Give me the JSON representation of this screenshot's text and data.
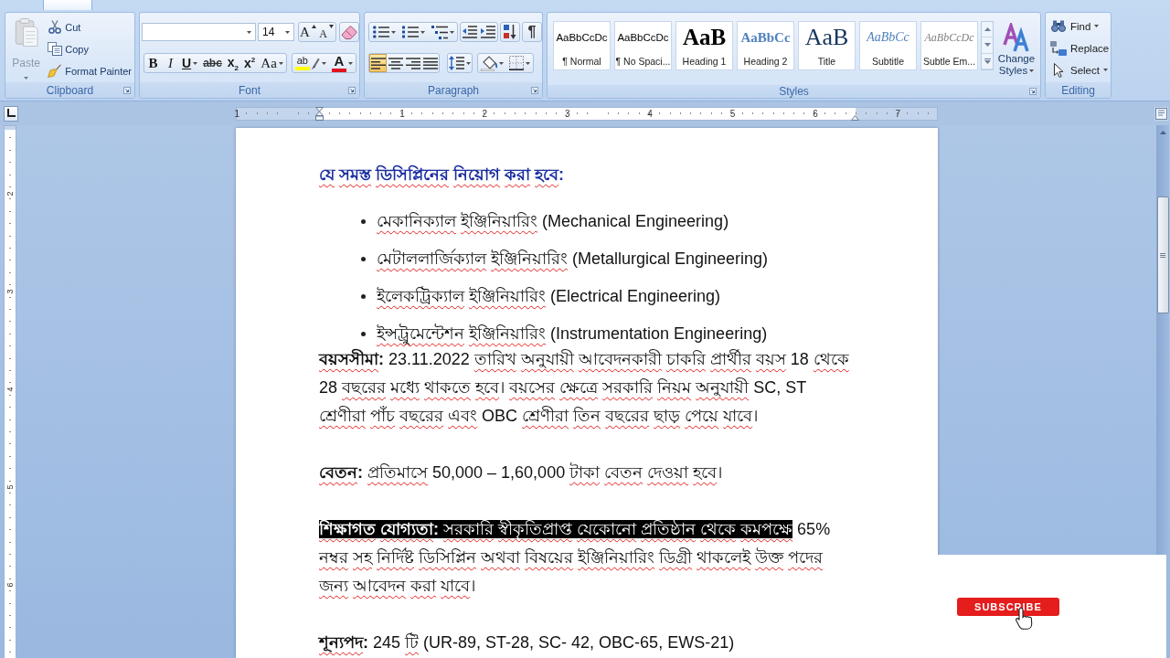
{
  "ribbon": {
    "clipboard": {
      "label": "Clipboard",
      "paste": {
        "label": "Paste",
        "disabled": true
      },
      "items": [
        {
          "kind": "cut",
          "label": "Cut",
          "disabled": false
        },
        {
          "kind": "copy",
          "label": "Copy",
          "disabled": false
        },
        {
          "kind": "painter",
          "label": "Format Painter",
          "disabled": false
        }
      ]
    },
    "font": {
      "label": "Font",
      "size": "14",
      "size_buttons": [
        {
          "kind": "grow",
          "label": "A"
        },
        {
          "kind": "shrink",
          "label": "A"
        }
      ],
      "formatting": [
        {
          "kind": "bold",
          "label": "B"
        },
        {
          "kind": "italic",
          "label": "I"
        },
        {
          "kind": "underline",
          "label": "U"
        },
        {
          "kind": "strike",
          "label": "abc"
        },
        {
          "kind": "subscript",
          "label": "x$_{2}$"
        },
        {
          "kind": "superscript",
          "label": "x$^{2}$"
        },
        {
          "kind": "case",
          "label": "Aa"
        }
      ],
      "highlight": {
        "label": "ab",
        "color": "#ffff00"
      },
      "font_color": {
        "label": "A",
        "color": "#e0141e"
      }
    },
    "paragraph": {
      "label": "Paragraph",
      "show_marks": "¶",
      "alignment": [
        {
          "kind": "left",
          "selected": true
        },
        {
          "kind": "center",
          "selected": false
        },
        {
          "kind": "right",
          "selected": false
        },
        {
          "kind": "justify",
          "selected": false
        }
      ]
    },
    "styles": {
      "label": "Styles",
      "gallery": [
        {
          "kind": "normal",
          "preview": "AaBbCcDc",
          "name": "¶ Normal"
        },
        {
          "kind": "no_spacing",
          "preview": "AaBbCcDc",
          "name": "¶ No Spaci..."
        },
        {
          "kind": "heading1",
          "preview": "AaB",
          "name": "Heading 1"
        },
        {
          "kind": "heading2",
          "preview": "AaBbCc",
          "name": "Heading 2"
        },
        {
          "kind": "title",
          "preview": "AaB",
          "name": "Title"
        },
        {
          "kind": "subtitle",
          "preview": "AaBbCc",
          "name": "Subtitle"
        },
        {
          "kind": "emphasis",
          "preview": "AaBbCcDc",
          "name": "Subtle Em..."
        }
      ],
      "change_styles": "Change Styles"
    },
    "editing": {
      "label": "Editing",
      "items": [
        {
          "kind": "find",
          "label": "Find"
        },
        {
          "kind": "replace",
          "label": "Replace"
        },
        {
          "kind": "select",
          "label": "Select"
        }
      ]
    }
  },
  "ruler": {
    "horizontal": [
      "1",
      "1",
      "2",
      "3",
      "4",
      "5",
      "6",
      "7"
    ],
    "vertical": [
      "2",
      "3",
      "4",
      "5",
      "6"
    ]
  },
  "document": {
    "heading": "যে সমস্ত ডিসিপ্লিনের নিয়োগ করা হবে:",
    "disciplines": [
      "মেকানিক্যাল ইঞ্জিনিয়ারিং (Mechanical Engineering)",
      "মেটাললার্জিক্যাল ইঞ্জিনিয়ারিং (Metallurgical Engineering)",
      "ইলেকট্রিক্যাল ইঞ্জিনিয়ারিং (Electrical Engineering)",
      "ইন্সট্রুমেন্টেশন ইঞ্জিনিয়ারিং (Instrumentation Engineering)"
    ],
    "paragraphs": [
      {
        "segments": [
          {
            "text": "**বয়সসীমা:** 23.11.2022 তারিখ অনুযায়ী আবেদনকারী চাকরি প্রার্থীর বয়স 18 থেকে 28 বছরের মধ্যে থাকতে হবে। বয়সের ক্ষেত্রে সরকারি নিয়ম অনুযায়ী SC, ST শ্রেণীরা পাঁচ বছরের এবং OBC শ্রেণীরা তিন বছরের ছাড় পেয়ে যাবে।",
            "selected": false
          }
        ]
      },
      {
        "segments": [
          {
            "text": "**বেতন:** প্রতিমাসে 50,000 – 1,60,000 টাকা বেতন দেওয়া হবে।",
            "selected": false
          }
        ]
      },
      {
        "segments": [
          {
            "text": "**শিক্ষাগত যোগ্যতা:** সরকারি স্বীকৃতিপ্রাপ্ত যেকোনো প্রতিষ্ঠান থেকে কমপক্ষে",
            "selected": true
          },
          {
            "text": " 65% নম্বর সহ নির্দিষ্ট ডিসিপ্লিন অথবা বিষয়ের ইঞ্জিনিয়ারিং ডিগ্রী থাকলেই উক্ত পদের জন্য আবেদন করা যাবে।",
            "selected": false
          }
        ]
      },
      {
        "segments": [
          {
            "text": "**শূন্যপদ:** 245 টি (UR-89, ST-28, SC- 42, OBC-65, EWS-21)",
            "selected": false
          }
        ]
      }
    ]
  },
  "overlay": {
    "button": "SUBSCRIBE"
  }
}
